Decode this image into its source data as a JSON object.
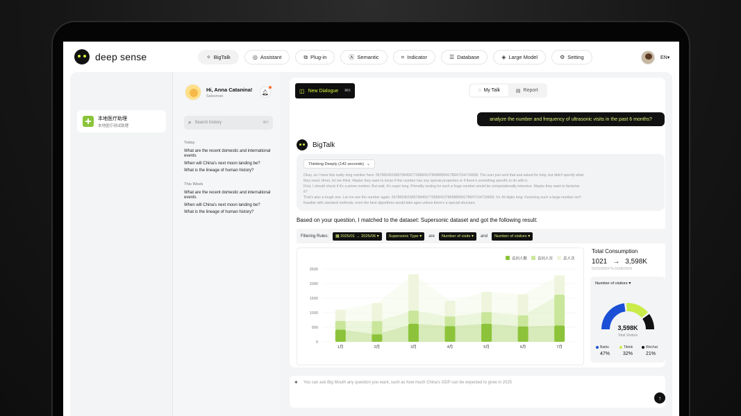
{
  "app": {
    "name": "deep sense",
    "lang": "EN"
  },
  "nav": [
    {
      "label": "BigTalk",
      "icon": "sparkle-icon"
    },
    {
      "label": "Assistant",
      "icon": "robot-icon"
    },
    {
      "label": "Plug-in",
      "icon": "plugin-icon"
    },
    {
      "label": "Semantic",
      "icon": "semantic-icon"
    },
    {
      "label": "Indicator",
      "icon": "indicator-icon"
    },
    {
      "label": "Database",
      "icon": "database-icon"
    },
    {
      "label": "Large Model",
      "icon": "model-icon"
    },
    {
      "label": "Setting",
      "icon": "gear-icon"
    }
  ],
  "left": {
    "title": "本地医疗助理",
    "subtitle": "本地医疗测试助理"
  },
  "history": {
    "greeting": "Hi, Anna Catanina!",
    "role": "Salesman",
    "search_placeholder": "Search history",
    "search_kbd": "⌘F",
    "today_label": "Today",
    "today": [
      "What are the recent domestic and international events",
      "When will China's next moon landing be?",
      "What is the lineage of human history?"
    ],
    "week_label": "This Week",
    "week": [
      "What are the recent domestic and international events",
      "When will China's next moon landing be?",
      "What is the lineage of human history?"
    ]
  },
  "main": {
    "new_dialogue": "New Dialogue",
    "new_dialogue_kbd": "⌘K",
    "tab_mytalk": "My Talk",
    "tab_report": "Report",
    "question": "analyze the number and frequency of ultrasonic visits in the past 6 months?",
    "bigtalk": "BigTalk",
    "thinking": "Thinking Deeply (142 seconds)",
    "thinking_text": [
      "Okay, so I have this really long number here: 567865451685768456770589410789988584178947154716658. The user just sent that and asked for help, but didn't specify what",
      "they need. Hmm, let me think. Maybe they want to know if this number has any special properties or if there's something specific to do with it.",
      "First, I should check if it's a prime number. But wait, it's super long. Primality testing for such a huge number would be computationally intensive. Maybe they want to factorize",
      "it?",
      "That's also a tough one. Let me see the number again. 567865451685768456770589410789988584178947154716658. It's 49 digits long. Factoring such a large number isn't",
      "feasible with standard methods; even the best algorithms would take ages unless there's a special structure."
    ],
    "result": "Based on your question, I matched to the dataset: Supersonic dataset and got the following result:",
    "filter_label": "Filtering Rules:",
    "filter_date": "2025/01 → 2025/06",
    "filter_type": "Supersonic Type",
    "filter_are": "are",
    "filter_metric1": "Number of visits",
    "filter_and": "and",
    "filter_metric2": "Number of visitors",
    "input_placeholder": "You can ask Big Mouth any question you want, such as how much China's GDP can be expected to grow in 2025"
  },
  "total": {
    "title": "Total Consumption",
    "from": "1021",
    "to": "3,598K",
    "date": "01/01/2024 To 01/06/2024",
    "selector": "Number of visitors",
    "center_value": "3,598K",
    "center_label": "Total Visitors",
    "legend": [
      {
        "name": "Baidu",
        "pct": "47%",
        "color": "#1a4fd6"
      },
      {
        "name": "Tiktok",
        "pct": "32%",
        "color": "#c9ec4a"
      },
      {
        "name": "Wechat",
        "pct": "21%",
        "color": "#111111"
      }
    ],
    "gauge_values": [
      47,
      32,
      21
    ]
  },
  "chart_data": {
    "type": "bar",
    "categories": [
      "1月",
      "2月",
      "3月",
      "4月",
      "5月",
      "6月",
      "7月"
    ],
    "ylim": [
      0,
      2500
    ],
    "yticks": [
      0,
      500,
      1000,
      1500,
      2000,
      2500
    ],
    "series": [
      {
        "name": "访问人数",
        "values": [
          420,
          260,
          620,
          540,
          620,
          530,
          560
        ],
        "color": "#8cc33a"
      },
      {
        "name": "访问人次",
        "values": [
          300,
          450,
          450,
          330,
          400,
          380,
          1060
        ],
        "color": "#c9e69a"
      },
      {
        "name": "总人次",
        "values": [
          380,
          620,
          1250,
          540,
          700,
          720,
          660
        ],
        "color": "#eef5dc"
      }
    ]
  }
}
